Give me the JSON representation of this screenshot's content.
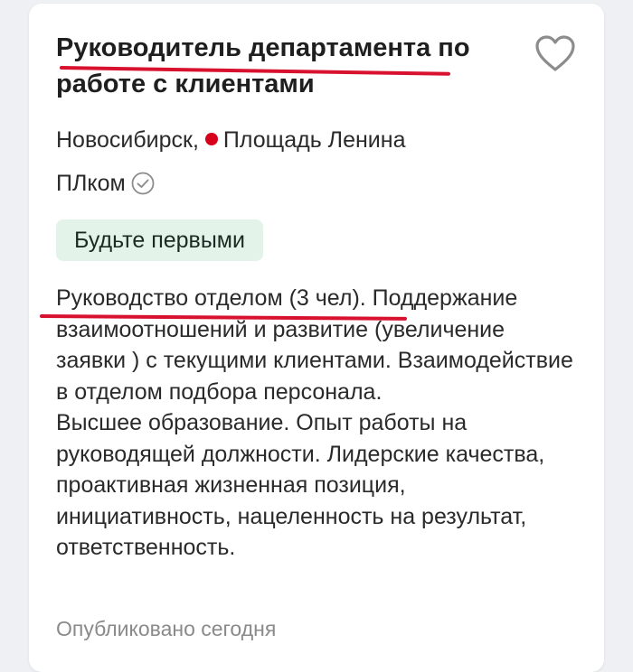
{
  "vacancy": {
    "title": "Руководитель департамента по работе с клиентами",
    "favorite_icon": "heart-outline-icon",
    "location": {
      "city": "Новосибирск,",
      "metro": "Площадь Ленина",
      "metro_color": "#d6001c"
    },
    "company": {
      "name": "ПЛком",
      "verified_icon": "check-circle-icon"
    },
    "badge": "Будьте первыми",
    "description": {
      "para1": "Руководство отделом (3 чел). Поддержание взаимоотношений и развитие (увеличение заявки ) с текущими клиентами. Взаимодействие в отделом подбора персонала.",
      "para2": "Высшее образование. Опыт работы на руководящей должности. Лидерские качества, проактивная жизненная позиция, инициативность, нацеленность на результат, ответственность."
    },
    "published": "Опубликовано сегодня"
  },
  "colors": {
    "annotation": "#d8112e",
    "badge_bg": "#e3f3ea",
    "icon_gray": "#8c8c8c"
  }
}
